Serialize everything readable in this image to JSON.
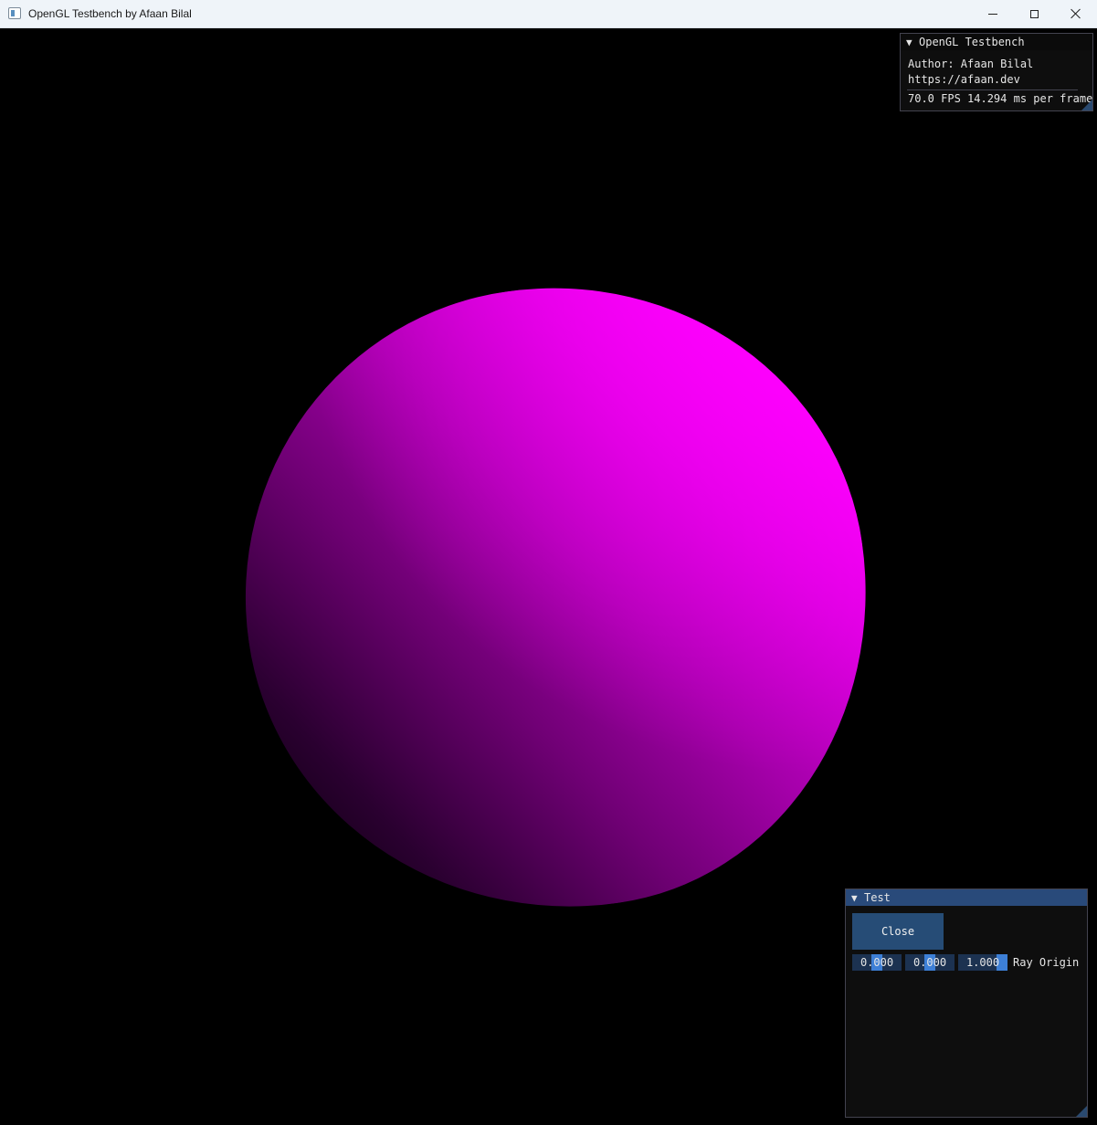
{
  "window": {
    "title": "OpenGL Testbench by Afaan Bilal"
  },
  "viewport": {
    "object": "sphere",
    "object_color": "#ff00ff",
    "background_color": "#000000"
  },
  "info_panel": {
    "title": "OpenGL Testbench",
    "author": "Author: Afaan Bilal",
    "url": "https://afaan.dev",
    "fps": "70.0 FPS 14.294 ms per frame"
  },
  "test_panel": {
    "title": "Test",
    "close_label": "Close",
    "ray_origin": {
      "x": "0.000",
      "y": "0.000",
      "z": "1.000",
      "label": "Ray Origin"
    }
  },
  "icons": {
    "collapse_arrow": "▼"
  }
}
